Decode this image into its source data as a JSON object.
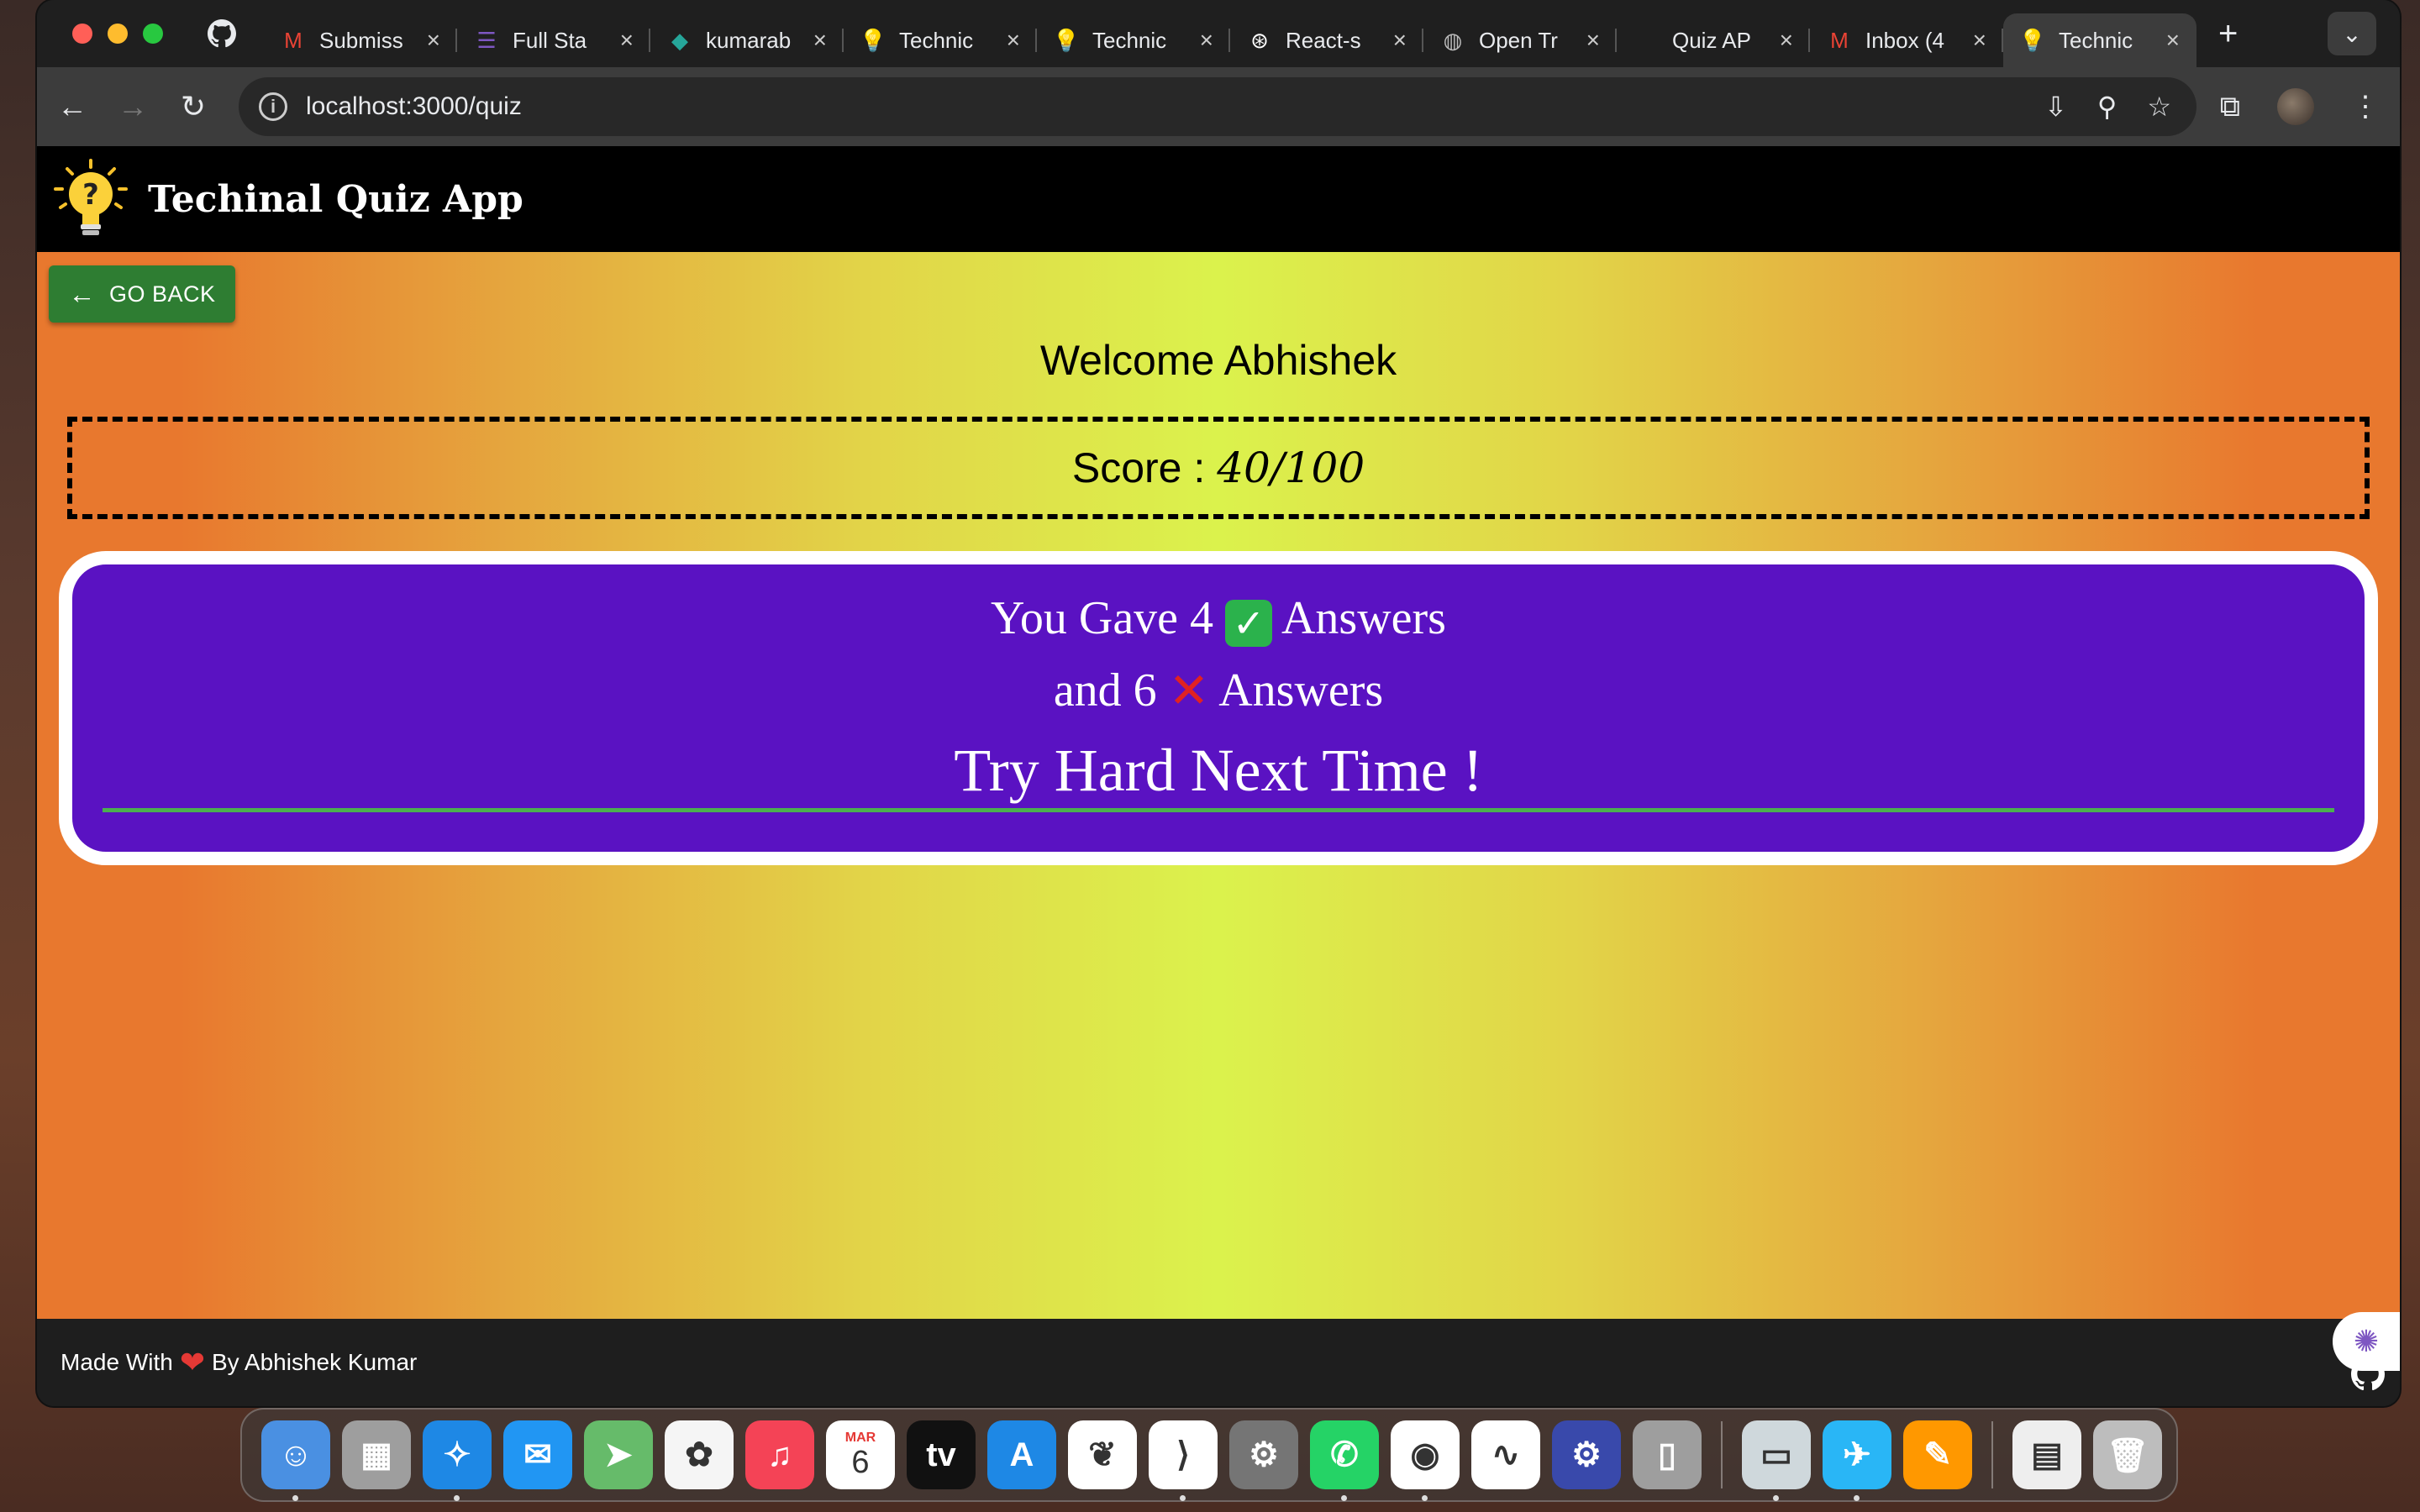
{
  "browser": {
    "tabs": [
      {
        "label": "Submiss",
        "icon": "gmail-icon",
        "glyph": "M",
        "color": "#ea4335"
      },
      {
        "label": "Full Sta",
        "icon": "forms-icon",
        "glyph": "☰",
        "color": "#7e57c2"
      },
      {
        "label": "kumarab",
        "icon": "diamond-icon",
        "glyph": "◆",
        "color": "#26a69a"
      },
      {
        "label": "Technic",
        "icon": "bulb-icon",
        "glyph": "💡",
        "color": "#fbc02d"
      },
      {
        "label": "Technic",
        "icon": "bulb-icon",
        "glyph": "💡",
        "color": "#fbc02d"
      },
      {
        "label": "React-s",
        "icon": "openai-icon",
        "glyph": "⊛",
        "color": "#ffffff"
      },
      {
        "label": "Open Tr",
        "icon": "globe-icon",
        "glyph": "◍",
        "color": "#bbbbbb"
      },
      {
        "label": "Quiz AP",
        "icon": "blank-icon",
        "glyph": "",
        "color": "#bbbbbb"
      },
      {
        "label": "Inbox (4",
        "icon": "gmail-icon",
        "glyph": "M",
        "color": "#ea4335"
      },
      {
        "label": "Technic",
        "icon": "bulb-icon",
        "glyph": "💡",
        "color": "#fbc02d",
        "active": true
      }
    ],
    "url": "localhost:3000/quiz"
  },
  "app": {
    "title": "Techinal Quiz App",
    "go_back_label": "GO BACK",
    "welcome": "Welcome Abhishek",
    "score_label": "Score :",
    "score_value": "40/100",
    "result": {
      "line1_prefix": "You Gave 4",
      "line1_suffix": "Answers",
      "line2_prefix": "and 6",
      "line2_suffix": "Answers",
      "message": "Try Hard Next Time !"
    },
    "footer": {
      "made_with": "Made With",
      "by": "By Abhishek Kumar"
    }
  },
  "dock": {
    "apps": [
      {
        "name": "finder-icon",
        "bg": "#4a90e2",
        "glyph": "☺"
      },
      {
        "name": "launchpad-icon",
        "bg": "#9e9e9e",
        "glyph": "▦"
      },
      {
        "name": "safari-icon",
        "bg": "#1e88e5",
        "glyph": "✧"
      },
      {
        "name": "mail-icon",
        "bg": "#2196f3",
        "glyph": "✉"
      },
      {
        "name": "maps-icon",
        "bg": "#66bb6a",
        "glyph": "➤"
      },
      {
        "name": "photos-icon",
        "bg": "#f5f5f5",
        "glyph": "✿"
      },
      {
        "name": "music-icon",
        "bg": "#f44356",
        "glyph": "♫"
      },
      {
        "name": "calendar-icon",
        "bg": "#ffffff",
        "glyph": "6"
      },
      {
        "name": "tv-icon",
        "bg": "#111111",
        "glyph": "tv"
      },
      {
        "name": "appstore-icon",
        "bg": "#1e88e5",
        "glyph": "A"
      },
      {
        "name": "mongodb-icon",
        "bg": "#ffffff",
        "glyph": "❦"
      },
      {
        "name": "vscode-icon",
        "bg": "#ffffff",
        "glyph": "⟩"
      },
      {
        "name": "settings-icon",
        "bg": "#757575",
        "glyph": "⚙"
      },
      {
        "name": "whatsapp-icon",
        "bg": "#25d366",
        "glyph": "✆"
      },
      {
        "name": "chrome-icon",
        "bg": "#ffffff",
        "glyph": "◉"
      },
      {
        "name": "freeform-icon",
        "bg": "#ffffff",
        "glyph": "∿"
      },
      {
        "name": "gearapp-icon",
        "bg": "#3949ab",
        "glyph": "⚙"
      },
      {
        "name": "iphone-mirror-icon",
        "bg": "#9e9e9e",
        "glyph": "▯"
      },
      {
        "name": "preview-icon",
        "bg": "#cfd8dc",
        "glyph": "▭"
      },
      {
        "name": "telegram-icon",
        "bg": "#29b6f6",
        "glyph": "✈"
      },
      {
        "name": "pages-icon",
        "bg": "#ff9800",
        "glyph": "✎"
      },
      {
        "name": "docx-icon",
        "bg": "#eeeeee",
        "glyph": "▤"
      },
      {
        "name": "trash-icon",
        "bg": "#bdbdbd",
        "glyph": "🗑"
      }
    ],
    "calendar_month": "MAR"
  }
}
